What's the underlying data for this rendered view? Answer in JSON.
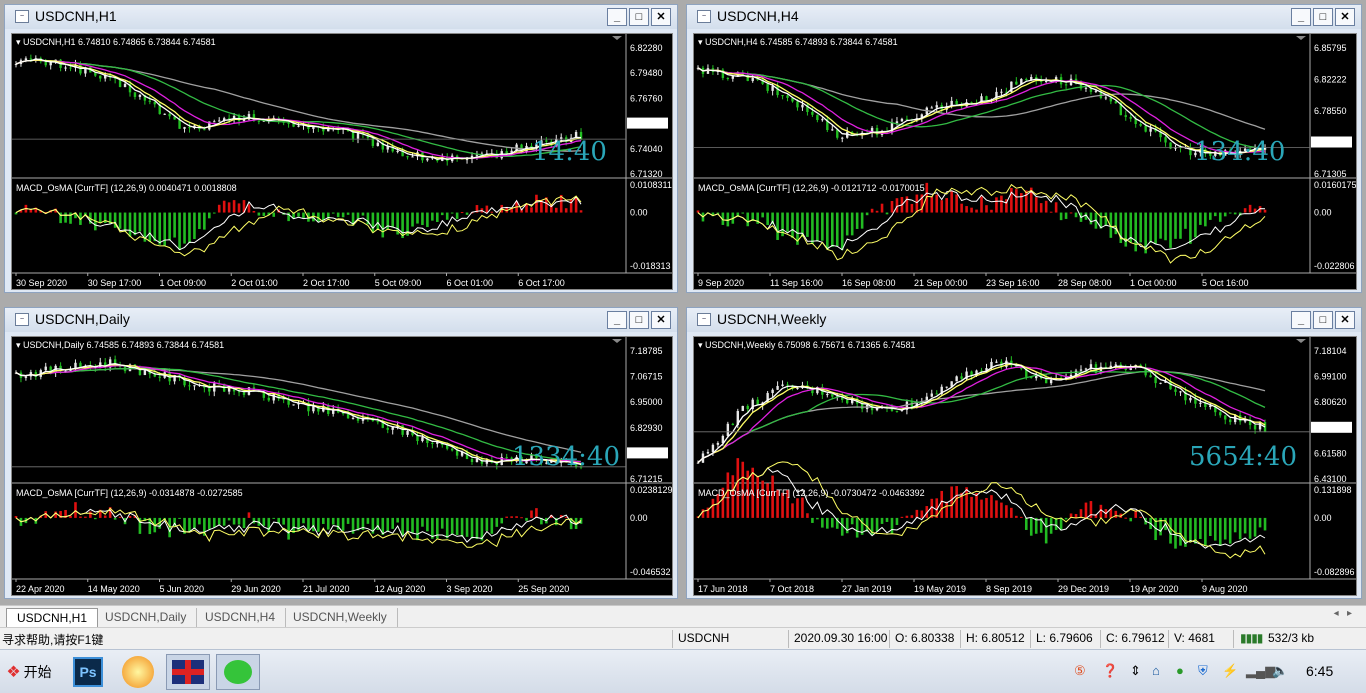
{
  "windows": [
    {
      "title": "USDCNH,H1",
      "info": "USDCNH,H1  6.74810 6.74865 6.73844 6.74581",
      "prices": [
        "6.82280",
        "6.79480",
        "6.76760",
        "6.74581",
        "6.74040",
        "6.71320"
      ],
      "timer": "14:40",
      "macd_label": "MACD_OsMA [CurrTF] (12,26,9) 0.0040471 0.0018808",
      "macd_scale": [
        "0.0108311",
        "0.00",
        "-0.018313"
      ],
      "dates": [
        "30 Sep 2020",
        "30 Sep 17:00",
        "1 Oct 09:00",
        "2 Oct 01:00",
        "2 Oct 17:00",
        "5 Oct 09:00",
        "6 Oct 01:00",
        "6 Oct 17:00"
      ]
    },
    {
      "title": "USDCNH,H4",
      "info": "USDCNH,H4  6.74585 6.74893 6.73844 6.74581",
      "prices": [
        "6.85795",
        "6.82222",
        "6.78550",
        "6.74581",
        "6.71305"
      ],
      "timer": "134:40",
      "macd_label": "MACD_OsMA [CurrTF] (12,26,9) -0.0121712 -0.0170015",
      "macd_scale": [
        "0.0160175",
        "0.00",
        "-0.022806"
      ],
      "dates": [
        "9 Sep 2020",
        "11 Sep 16:00",
        "16 Sep 08:00",
        "21 Sep 00:00",
        "23 Sep 16:00",
        "28 Sep 08:00",
        "1 Oct 00:00",
        "5 Oct 16:00"
      ]
    },
    {
      "title": "USDCNH,Daily",
      "info": "USDCNH,Daily  6.74585 6.74893 6.73844 6.74581",
      "prices": [
        "7.18785",
        "7.06715",
        "6.95000",
        "6.82930",
        "6.74581",
        "6.71215"
      ],
      "timer": "1334:40",
      "macd_label": "MACD_OsMA [CurrTF] (12,26,9) -0.0314878 -0.0272585",
      "macd_scale": [
        "0.0238129",
        "0.00",
        "-0.046532"
      ],
      "dates": [
        "22 Apr 2020",
        "14 May 2020",
        "5 Jun 2020",
        "29 Jun 2020",
        "21 Jul 2020",
        "12 Aug 2020",
        "3 Sep 2020",
        "25 Sep 2020"
      ]
    },
    {
      "title": "USDCNH,Weekly",
      "info": "USDCNH,Weekly  6.75098 6.75671 6.71365 6.74581",
      "prices": [
        "7.18104",
        "6.99100",
        "6.80620",
        "6.74581",
        "6.61580",
        "6.43100"
      ],
      "timer": "5654:40",
      "macd_label": "MACD_OsMA [CurrTF] (12,26,9) -0.0730472 -0.0463392",
      "macd_scale": [
        "0.131898",
        "0.00",
        "-0.082896"
      ],
      "dates": [
        "17 Jun 2018",
        "7 Oct 2018",
        "27 Jan 2019",
        "19 May 2019",
        "8 Sep 2019",
        "29 Dec 2019",
        "19 Apr 2020",
        "9 Aug 2020"
      ]
    }
  ],
  "tabs": [
    "USDCNH,H1",
    "USDCNH,Daily",
    "USDCNH,H4",
    "USDCNH,Weekly"
  ],
  "status": {
    "help": "寻求帮助,请按F1键",
    "symbol": "USDCNH",
    "datetime": "2020.09.30 16:00",
    "open": "O: 6.80338",
    "high": "H: 6.80512",
    "low": "L: 6.79606",
    "close": "C: 6.79612",
    "volume": "V: 4681",
    "traffic": "532/3 kb"
  },
  "taskbar": {
    "start_label": "开始",
    "ps_label": "Ps",
    "clock": "6:45"
  },
  "colors": {
    "bull": "#e8e8e8",
    "bear": "#22c022",
    "ma_fast": "#ffff66",
    "ma_white": "#ffffff",
    "ma_magenta": "#e020e0",
    "ma_green": "#33bb44",
    "ma_gray": "#a0a0a0",
    "hist_up": "#e01010",
    "hist_down": "#22bb22",
    "timer": "#2aa6b8"
  }
}
